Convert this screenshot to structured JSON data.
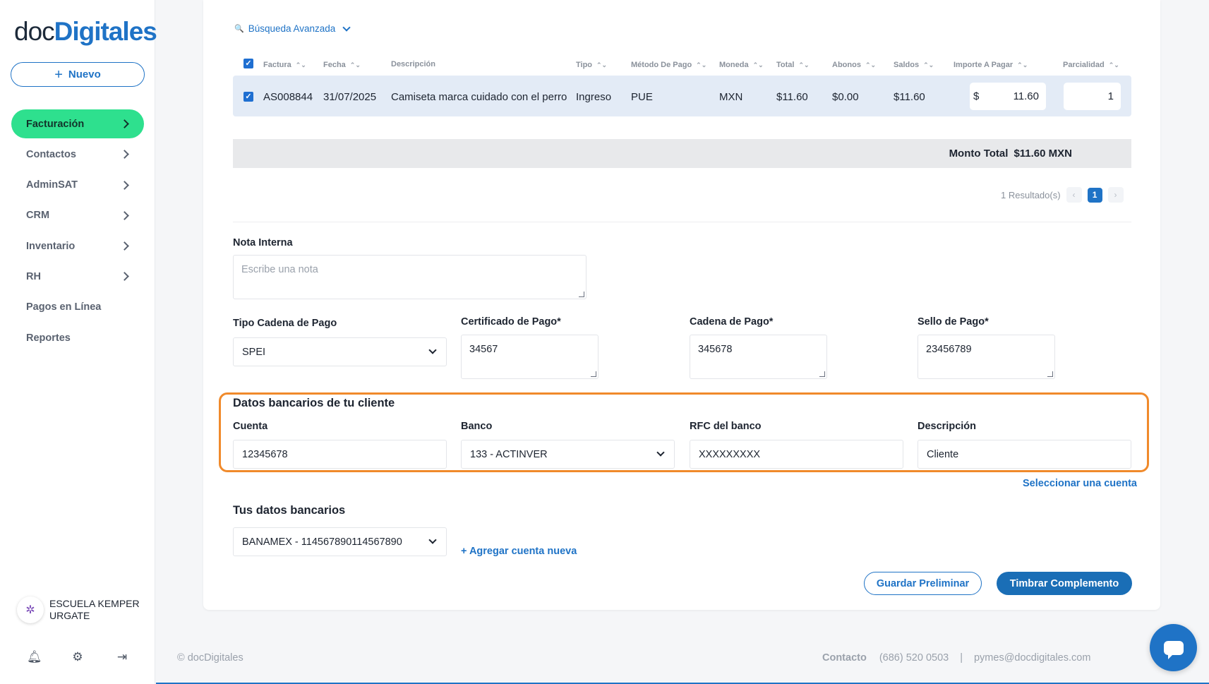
{
  "sidebar": {
    "logo_part1": "doc",
    "logo_part2": "Digitales",
    "new_button_icon": "+",
    "new_button_label": "Nuevo",
    "items": [
      {
        "label": "Facturación",
        "active": true,
        "has_chevron": true
      },
      {
        "label": "Contactos",
        "has_chevron": true
      },
      {
        "label": "AdminSAT",
        "has_chevron": true
      },
      {
        "label": "CRM",
        "has_chevron": true
      },
      {
        "label": "Inventario",
        "has_chevron": true
      },
      {
        "label": "RH",
        "has_chevron": true
      },
      {
        "label": "Pagos en Línea",
        "has_chevron": false
      },
      {
        "label": "Reportes",
        "has_chevron": false
      }
    ],
    "user_name": "ESCUELA KEMPER URGATE",
    "avatar_icon": "school-logo-icon",
    "bottom_icons": [
      "bell-icon",
      "gear-icon",
      "logout-icon"
    ]
  },
  "search": {
    "icon": "🔍",
    "label": "Búsqueda Avanzada"
  },
  "table": {
    "columns": {
      "factura": "Factura",
      "fecha": "Fecha",
      "descripcion": "Descripción",
      "tipo": "Tipo",
      "metodo": "Método De Pago",
      "moneda": "Moneda",
      "total": "Total",
      "abonos": "Abonos",
      "saldos": "Saldos",
      "importe": "Importe A Pagar",
      "parcialidad": "Parcialidad"
    },
    "sort_glyph": "⌃⌄",
    "row": {
      "factura": "AS008844",
      "fecha": "31/07/2025",
      "descripcion": "Camiseta marca cuidado con el perro",
      "tipo": "Ingreso",
      "metodo": "PUE",
      "moneda": "MXN",
      "total": "$11.60",
      "abonos": "$0.00",
      "saldos": "$11.60",
      "importe_symbol": "$",
      "importe_value": "11.60",
      "parcialidad": "1"
    },
    "check_glyph": "✓"
  },
  "total": {
    "label": "Monto Total",
    "value": "$11.60 MXN"
  },
  "pager": {
    "results": "1 Resultado(s)",
    "prev": "‹",
    "current": "1",
    "next": "›"
  },
  "form": {
    "nota_label": "Nota Interna",
    "nota_placeholder": "Escribe una nota",
    "tipo_cadena_label": "Tipo Cadena de Pago",
    "tipo_cadena_value": "SPEI",
    "certificado_label": "Certificado de Pago*",
    "certificado_value": "34567",
    "cadena_label": "Cadena de Pago*",
    "cadena_value": "345678",
    "sello_label": "Sello de Pago*",
    "sello_value": "23456789"
  },
  "cliente_bank": {
    "title": "Datos bancarios de tu cliente",
    "cuenta_label": "Cuenta",
    "cuenta_value": "12345678",
    "banco_label": "Banco",
    "banco_value": "133 - ACTINVER",
    "rfc_label": "RFC del banco",
    "rfc_value": "XXXXXXXXX",
    "desc_label": "Descripción",
    "desc_value": "Cliente",
    "select_link": "Seleccionar una cuenta",
    "highlight_color": "#f08a2b"
  },
  "own_bank": {
    "title": "Tus datos bancarios",
    "value": "BANAMEX - 114567890114567890",
    "add_link": "+ Agregar cuenta nueva"
  },
  "actions": {
    "preliminar": "Guardar Preliminar",
    "timbrar": "Timbrar Complemento"
  },
  "footer": {
    "copyright": "© docDigitales",
    "contact_label": "Contacto",
    "phone": "(686) 520 0503",
    "separator": "|",
    "email": "pymes@docdigitales.com"
  },
  "colors": {
    "accent": "#1f73c6",
    "active_nav": "#2ee08e"
  }
}
